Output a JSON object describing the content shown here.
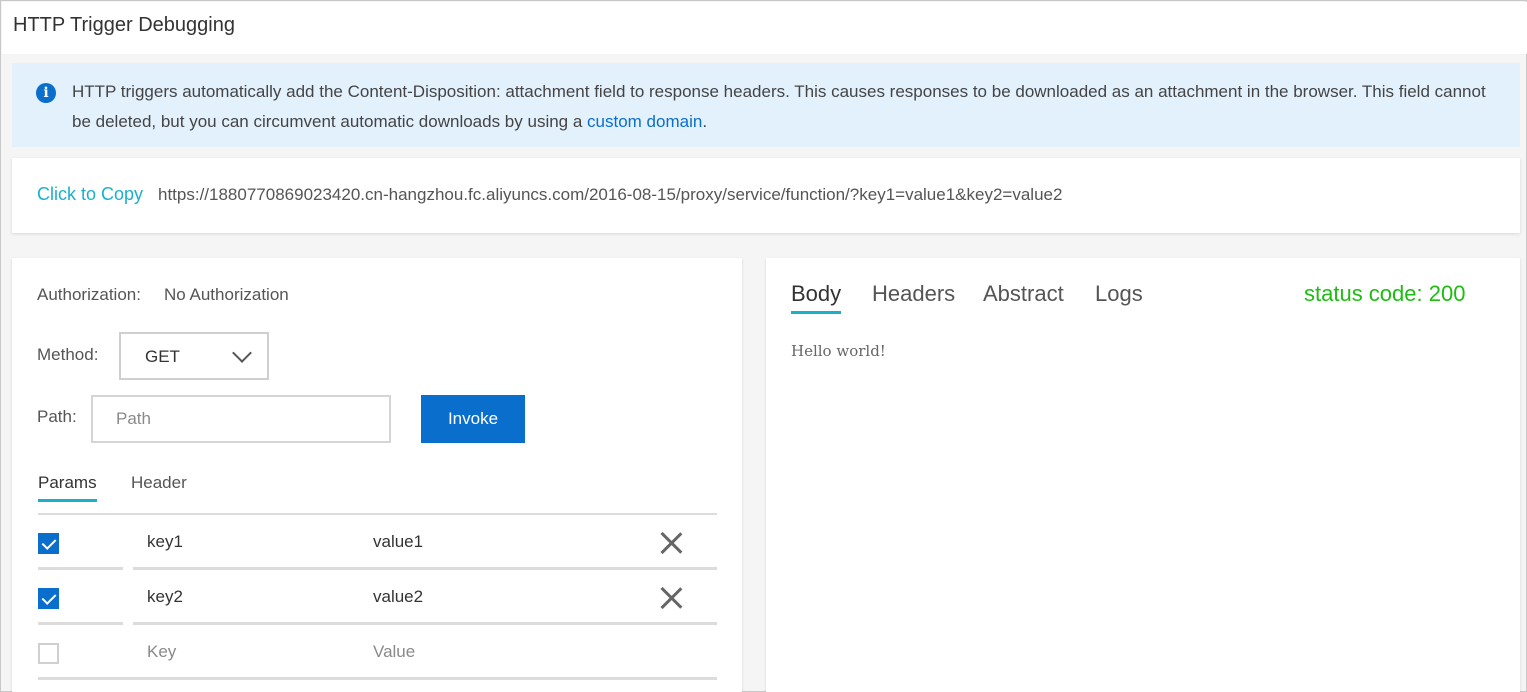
{
  "header": {
    "title": "HTTP Trigger Debugging"
  },
  "notice": {
    "icon": "info-icon",
    "text_before": "HTTP triggers automatically add the Content-Disposition: attachment field to response headers. This causes responses to be downloaded as an attachment in the browser. This field cannot be deleted, but you can circumvent automatic downloads by using a ",
    "link_text": "custom domain",
    "text_after": "."
  },
  "url_bar": {
    "copy_label": "Click to Copy",
    "url": "https://1880770869023420.cn-hangzhou.fc.aliyuncs.com/2016-08-15/proxy/service/function/?key1=value1&key2=value2"
  },
  "request": {
    "auth_label": "Authorization:",
    "auth_value": "No Authorization",
    "method_label": "Method:",
    "method_value": "GET",
    "path_label": "Path:",
    "path_placeholder": "Path",
    "invoke_label": "Invoke",
    "tabs": [
      {
        "label": "Params",
        "active": true
      },
      {
        "label": "Header",
        "active": false
      }
    ],
    "params": [
      {
        "checked": true,
        "key": "key1",
        "value": "value1"
      },
      {
        "checked": true,
        "key": "key2",
        "value": "value2"
      }
    ],
    "new_row": {
      "key_placeholder": "Key",
      "value_placeholder": "Value"
    }
  },
  "response": {
    "tabs": [
      {
        "label": "Body",
        "active": true
      },
      {
        "label": "Headers",
        "active": false
      },
      {
        "label": "Abstract",
        "active": false
      },
      {
        "label": "Logs",
        "active": false
      }
    ],
    "status": "status code: 200",
    "body": "Hello world!"
  },
  "colors": {
    "accent": "#0a6ecd",
    "tab_underline": "#1ab1c8",
    "status_ok": "#1dbd12",
    "notice_bg": "#e3f1fd"
  }
}
